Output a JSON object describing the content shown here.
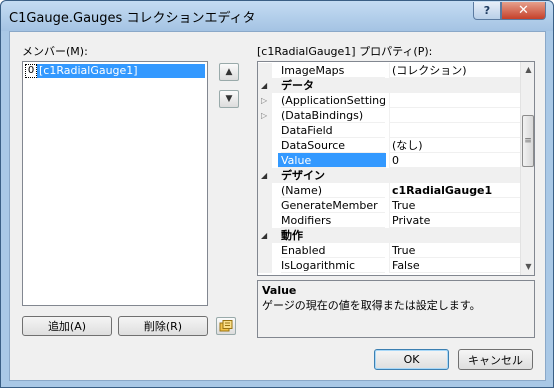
{
  "window": {
    "title": "C1Gauge.Gauges コレクションエディタ",
    "help_label": "?",
    "close_label": "✕"
  },
  "members": {
    "label": "メンバー(M):",
    "items": [
      {
        "index": "0",
        "name": "[c1RadialGauge1]"
      }
    ],
    "move_up_icon": "arrow-up-icon",
    "move_down_icon": "arrow-down-icon",
    "add_label": "追加(A)",
    "remove_label": "削除(R)"
  },
  "properties": {
    "label": "[c1RadialGauge1] プロパティ(P):",
    "rows": [
      {
        "kind": "prop",
        "name": "ImageMaps",
        "value": "(コレクション)"
      },
      {
        "kind": "category",
        "name": "データ"
      },
      {
        "kind": "prop",
        "name": "(ApplicationSettings)",
        "value": "",
        "expandable": true
      },
      {
        "kind": "prop",
        "name": "(DataBindings)",
        "value": "",
        "expandable": true
      },
      {
        "kind": "prop",
        "name": "DataField",
        "value": ""
      },
      {
        "kind": "prop",
        "name": "DataSource",
        "value": "(なし)"
      },
      {
        "kind": "prop",
        "name": "Value",
        "value": "0",
        "selected": true
      },
      {
        "kind": "category",
        "name": "デザイン"
      },
      {
        "kind": "prop",
        "name": "(Name)",
        "value": "c1RadialGauge1",
        "bold": true
      },
      {
        "kind": "prop",
        "name": "GenerateMember",
        "value": "True"
      },
      {
        "kind": "prop",
        "name": "Modifiers",
        "value": "Private"
      },
      {
        "kind": "category",
        "name": "動作"
      },
      {
        "kind": "prop",
        "name": "Enabled",
        "value": "True"
      },
      {
        "kind": "prop",
        "name": "IsLogarithmic",
        "value": "False"
      }
    ]
  },
  "description": {
    "title": "Value",
    "text": "ゲージの現在の値を取得または設定します。"
  },
  "footer": {
    "ok_label": "OK",
    "cancel_label": "キャンセル"
  }
}
